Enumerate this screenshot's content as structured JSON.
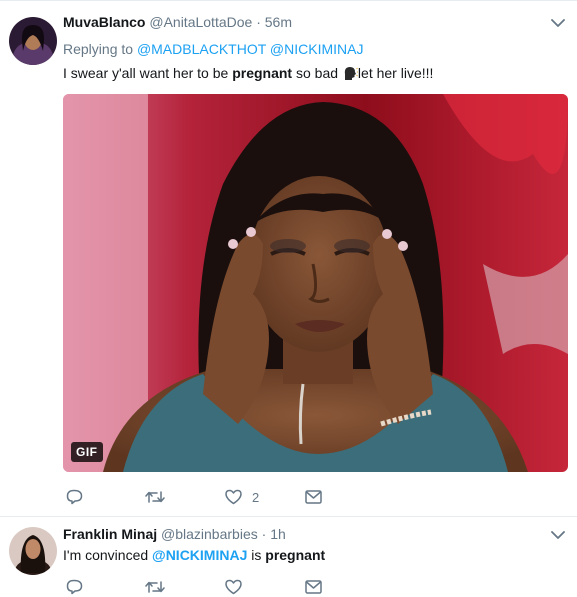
{
  "tweets": [
    {
      "display_name": "MuvaBlanco",
      "handle": "@AnitaLottaDoe",
      "separator": "·",
      "time": "56m",
      "replying_prefix": "Replying to",
      "reply_mentions": [
        "@MADBLACKTHOT",
        "@NICKIMINAJ"
      ],
      "text_before": "I swear y'all want her to be ",
      "text_bold": "pregnant",
      "text_middle": " so bad ",
      "text_after": "let her live!!!",
      "media_badge": "GIF",
      "like_count": "2"
    },
    {
      "display_name": "Franklin Minaj",
      "handle": "@blazinbarbies",
      "separator": "·",
      "time": "1h",
      "text_before": "I'm convinced ",
      "text_mention": "@NICKIMINAJ",
      "text_middle": " is ",
      "text_bold": "pregnant"
    }
  ],
  "colors": {
    "link": "#1da1f2",
    "muted": "#657786",
    "text": "#14171a",
    "divider": "#e6ecf0"
  },
  "icons": [
    "reply-icon",
    "retweet-icon",
    "like-icon",
    "dm-icon",
    "chevron-down-icon",
    "speaking-head-emoji"
  ]
}
